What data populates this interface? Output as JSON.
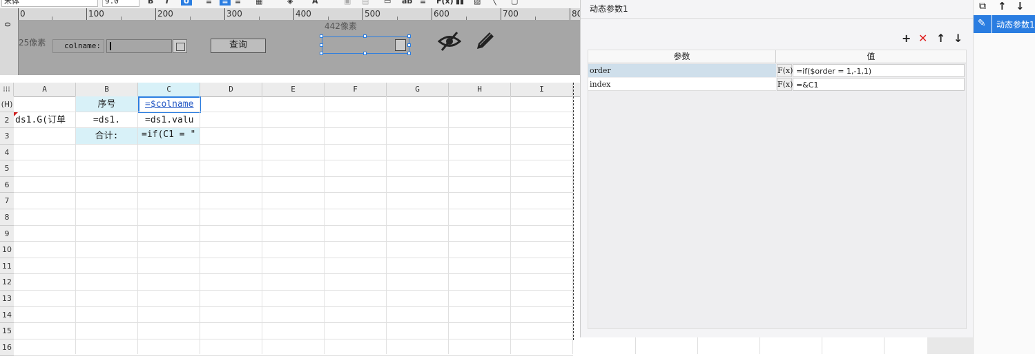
{
  "toolbar": {
    "font_name": "宋体",
    "font_size": "9.0",
    "bold": "B",
    "italic": "I",
    "underline": "U",
    "text_a": "ab",
    "fx": "F(x)"
  },
  "ruler": {
    "ticks": [
      "0",
      "100",
      "200",
      "300",
      "400",
      "500",
      "600",
      "700",
      "80"
    ],
    "v_tick": "0"
  },
  "param_panel": {
    "height_label": "25像素",
    "width_label": "442像素",
    "colname_label": "colname:",
    "query_button": "查询",
    "hide_icon": "eye-slash-icon",
    "edit_icon": "pencil-icon"
  },
  "grid": {
    "columns": [
      "A",
      "B",
      "C",
      "D",
      "E",
      "F",
      "G",
      "H",
      "I"
    ],
    "rows": [
      "(H)",
      "2",
      "3",
      "4",
      "5",
      "6",
      "7",
      "8",
      "9",
      "10",
      "11",
      "12",
      "13",
      "14",
      "15",
      "16"
    ],
    "cells": {
      "B1": "序号",
      "C1": "=$colname",
      "A2": "ds1.G(订单",
      "B2": "=ds1.",
      "C2": "=ds1.valu",
      "B3": "合计:",
      "C3": "=if(C1 = \""
    }
  },
  "dialog": {
    "title": "动态参数1",
    "toolbar": {
      "add": "+",
      "delete": "✕",
      "up": "↑",
      "down": "↓"
    },
    "headers": {
      "param": "参数",
      "value": "值"
    },
    "params": [
      {
        "name": "order",
        "fx": "F(x)",
        "value": "=if($order = 1,-1,1)"
      },
      {
        "name": "index",
        "fx": "F(x)",
        "value": "=&C1"
      }
    ]
  },
  "right_panel": {
    "item": "动态参数1",
    "up": "↑",
    "down": "↓"
  },
  "colors": {
    "accent": "#2a7de1",
    "header_cell": "#d8f1f8",
    "selected_row": "#cfdfeb",
    "panel_gray": "#a6a6a6"
  }
}
